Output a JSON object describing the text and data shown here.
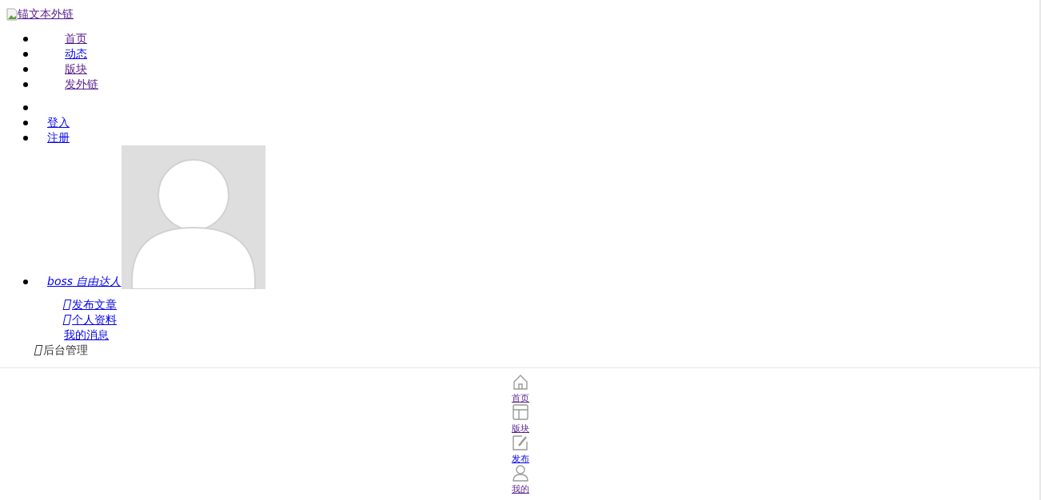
{
  "logo": {
    "alt": "锚文本外链",
    "visited": true
  },
  "nav": [
    {
      "label": "首页",
      "visited": true
    },
    {
      "label": "动态",
      "visited": false
    },
    {
      "label": "版块",
      "visited": true
    },
    {
      "label": "发外链",
      "visited": true
    }
  ],
  "user_links": [
    {
      "label": "登入",
      "visited": false
    },
    {
      "label": "注册",
      "visited": false
    }
  ],
  "account": {
    "name": "boss 自由达人",
    "visited": false
  },
  "submenu": [
    {
      "label": "发布文章",
      "icon": true,
      "visited": false
    },
    {
      "label": "个人资料",
      "icon": true,
      "visited": false
    },
    {
      "label": "我的消息",
      "icon": false,
      "visited": false
    }
  ],
  "admin": {
    "label": "后台管理",
    "icon": true
  },
  "tabbar": [
    {
      "kind": "home",
      "label": "首页",
      "visited": true
    },
    {
      "kind": "board",
      "label": "版块",
      "visited": true
    },
    {
      "kind": "post",
      "label": "发布",
      "visited": false
    },
    {
      "kind": "me",
      "label": "我的",
      "visited": true
    }
  ]
}
